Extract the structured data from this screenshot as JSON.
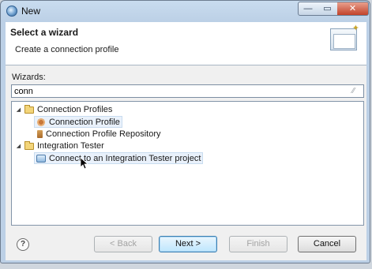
{
  "window": {
    "title": "New"
  },
  "header": {
    "title": "Select a wizard",
    "description": "Create a connection profile"
  },
  "filter": {
    "label": "Wizards:",
    "value": "conn"
  },
  "tree": [
    {
      "label": "Connection Profiles",
      "type": "category"
    },
    {
      "label": "Connection Profile",
      "type": "item",
      "icon": "connection-profile-icon"
    },
    {
      "label": "Connection Profile Repository",
      "type": "item",
      "icon": "repository-icon"
    },
    {
      "label": "Integration Tester",
      "type": "category"
    },
    {
      "label": "Connect to an Integration Tester project",
      "type": "item",
      "icon": "integration-tester-icon"
    }
  ],
  "buttons": {
    "back": "< Back",
    "next": "Next >",
    "finish": "Finish",
    "cancel": "Cancel"
  },
  "controls": {
    "minimize": "—",
    "maximize": "▭",
    "close": "✕",
    "help": "?"
  },
  "colors": {
    "selection": "#e9f1fb",
    "default_button": "#3c7fb1"
  }
}
